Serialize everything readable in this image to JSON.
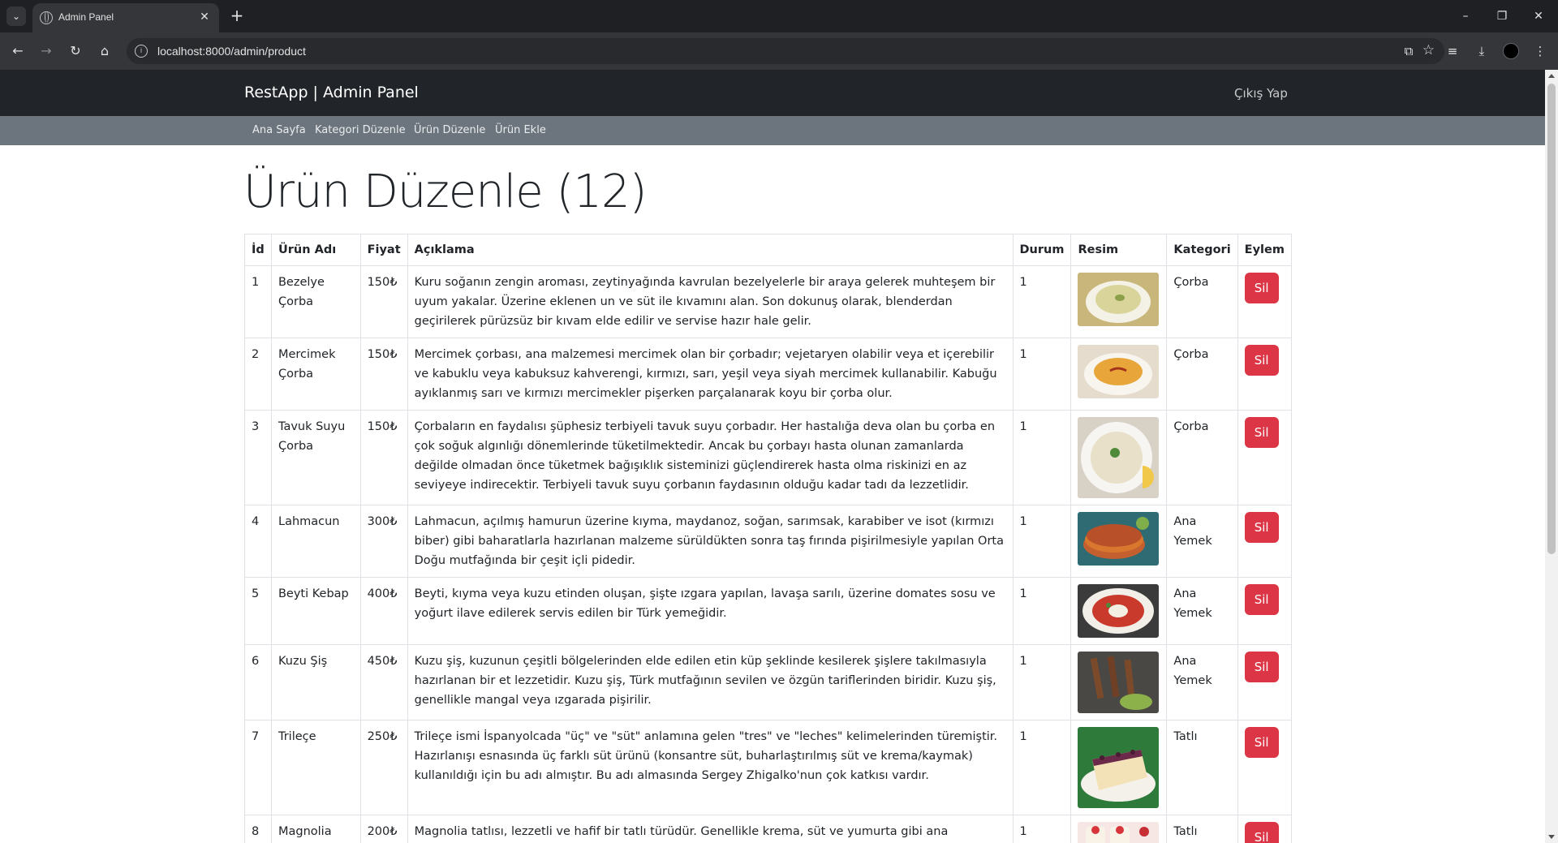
{
  "browser": {
    "tab_title": "Admin Panel",
    "url": "localhost:8000/admin/product"
  },
  "navbar": {
    "brand": "RestApp | Admin Panel",
    "logout": "Çıkış Yap"
  },
  "subnav": {
    "items": [
      "Ana Sayfa",
      "Kategori Düzenle",
      "Ürün Düzenle",
      "Ürün Ekle"
    ]
  },
  "page": {
    "title": "Ürün Düzenle (12)"
  },
  "table": {
    "headers": {
      "id": "İd",
      "name": "Ürün Adı",
      "price": "Fiyat",
      "desc": "Açıklama",
      "status": "Durum",
      "image": "Resim",
      "category": "Kategori",
      "action": "Eylem"
    },
    "delete_label": "Sil",
    "rows": [
      {
        "id": "1",
        "name": "Bezelye Çorba",
        "price": "150₺",
        "desc": "Kuru soğanın zengin aroması, zeytinyağında kavrulan bezelyelerle bir araya gelerek muhteşem bir uyum yakalar. Üzerine eklenen un ve süt ile kıvamını alan. Son dokunuş olarak, blenderdan geçirilerek pürüzsüz bir kıvam elde edilir ve servise hazır hale gelir.",
        "status": "1",
        "category": "Çorba"
      },
      {
        "id": "2",
        "name": "Mercimek Çorba",
        "price": "150₺",
        "desc": "Mercimek çorbası, ana malzemesi mercimek olan bir çorbadır; vejetaryen olabilir veya et içerebilir ve kabuklu veya kabuksuz kahverengi, kırmızı, sarı, yeşil veya siyah mercimek kullanabilir. Kabuğu ayıklanmış sarı ve kırmızı mercimekler pişerken parçalanarak koyu bir çorba olur.",
        "status": "1",
        "category": "Çorba"
      },
      {
        "id": "3",
        "name": "Tavuk Suyu Çorba",
        "price": "150₺",
        "desc": "Çorbaların en faydalısı şüphesiz terbiyeli tavuk suyu çorbadır. Her hastalığa deva olan bu çorba en çok soğuk algınlığı dönemlerinde tüketilmektedir. Ancak bu çorbayı hasta olunan zamanlarda değilde olmadan önce tüketmek bağışıklık sisteminizi güçlendirerek hasta olma riskinizi en az seviyeye indirecektir. Terbiyeli tavuk suyu çorbanın faydasının olduğu kadar tadı da lezzetlidir.",
        "status": "1",
        "category": "Çorba"
      },
      {
        "id": "4",
        "name": "Lahmacun",
        "price": "300₺",
        "desc": "Lahmacun, açılmış hamurun üzerine kıyma, maydanoz, soğan, sarımsak, karabiber ve isot (kırmızı biber) gibi baharatlarla hazırlanan malzeme sürüldükten sonra taş fırında pişirilmesiyle yapılan Orta Doğu mutfağında bir çeşit içli pidedir.",
        "status": "1",
        "category": "Ana Yemek"
      },
      {
        "id": "5",
        "name": "Beyti Kebap",
        "price": "400₺",
        "desc": "Beyti, kıyma veya kuzu etinden oluşan, şişte ızgara yapılan, lavaşa sarılı, üzerine domates sosu ve yoğurt ilave edilerek servis edilen bir Türk yemeğidir.",
        "status": "1",
        "category": "Ana Yemek"
      },
      {
        "id": "6",
        "name": "Kuzu Şiş",
        "price": "450₺",
        "desc": "Kuzu şiş, kuzunun çeşitli bölgelerinden elde edilen etin küp şeklinde kesilerek şişlere takılmasıyla hazırlanan bir et lezzetidir. Kuzu şiş, Türk mutfağının sevilen ve özgün tariflerinden biridir. Kuzu şiş, genellikle mangal veya ızgarada pişirilir.",
        "status": "1",
        "category": "Ana Yemek"
      },
      {
        "id": "7",
        "name": "Trileçe",
        "price": "250₺",
        "desc": "Trileçe ismi İspanyolcada \"üç\" ve \"süt\" anlamına gelen \"tres\" ve \"leches\" kelimelerinden türemiştir. Hazırlanışı esnasında üç farklı süt ürünü (konsantre süt, buharlaştırılmış süt ve krema/kaymak) kullanıldığı için bu adı almıştır. Bu adı almasında Sergey Zhigalko'nun çok katkısı vardır.",
        "status": "1",
        "category": "Tatlı"
      },
      {
        "id": "8",
        "name": "Magnolia",
        "price": "200₺",
        "desc": "Magnolia tatlısı, lezzetli ve hafif bir tatlı türüdür. Genellikle krema, süt ve yumurta gibi ana malzemelerle",
        "status": "1",
        "category": "Tatlı"
      }
    ]
  },
  "colors": {
    "navbar": "#212529",
    "subnav": "#6c757d",
    "danger": "#dc3545"
  }
}
